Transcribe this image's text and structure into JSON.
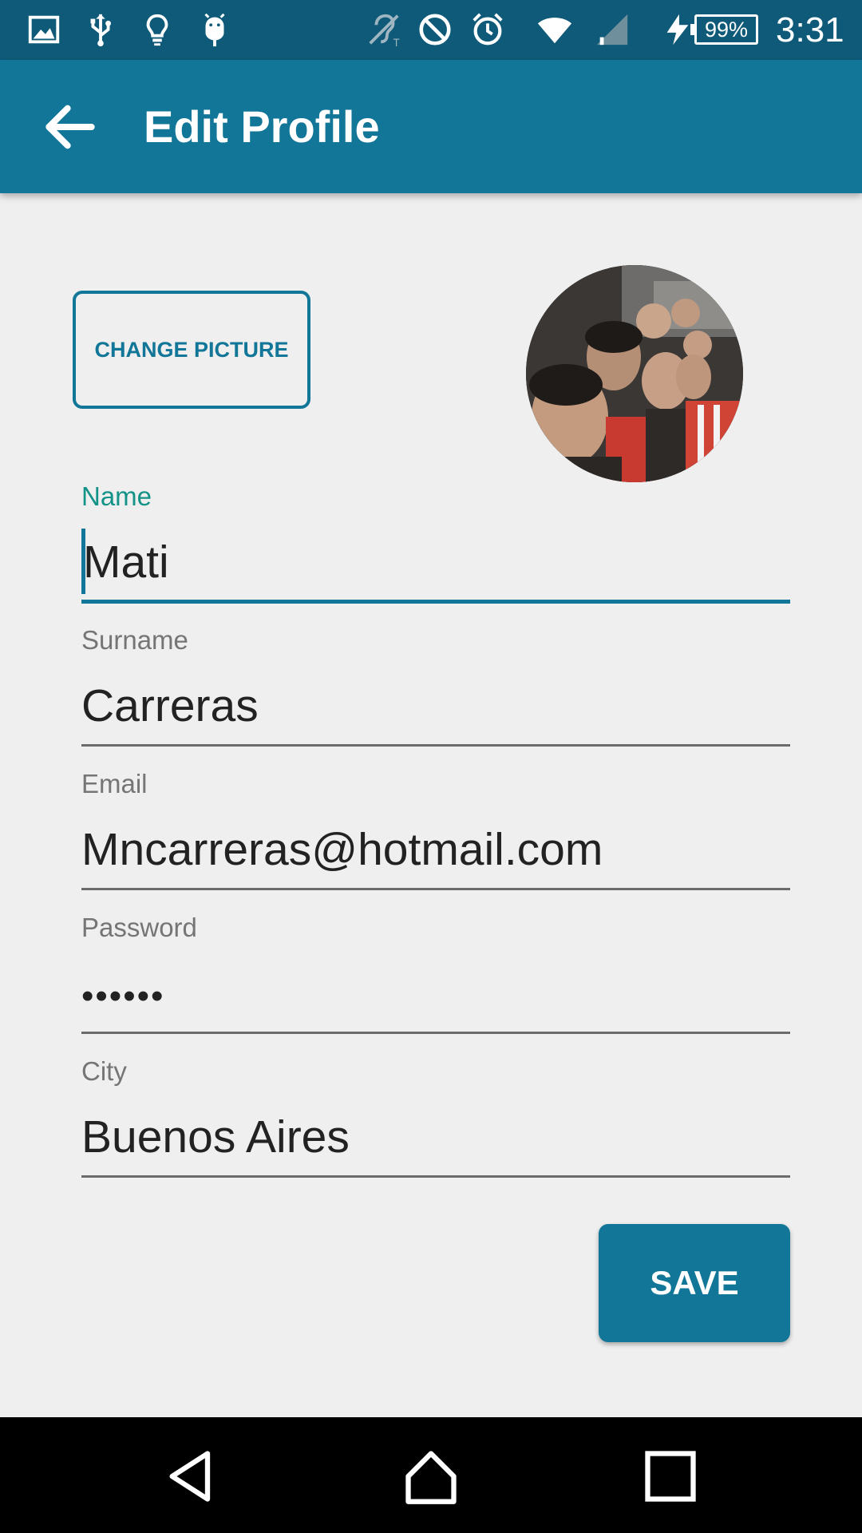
{
  "status_bar": {
    "battery_level": "99%",
    "time": "3:31",
    "icons": [
      "image-icon",
      "usb-icon",
      "lightbulb-icon",
      "android-icon",
      "hearing-aid-icon",
      "do-not-disturb-icon",
      "alarm-icon",
      "wifi-icon",
      "signal-icon",
      "charging-icon",
      "battery-icon"
    ]
  },
  "app_bar": {
    "title": "Edit Profile",
    "back_icon": "arrow-back-icon"
  },
  "profile": {
    "change_picture_label": "CHANGE PICTURE",
    "avatar_alt": "profile-photo"
  },
  "form": {
    "name": {
      "label": "Name",
      "value": "Mati"
    },
    "surname": {
      "label": "Surname",
      "value": "Carreras"
    },
    "email": {
      "label": "Email",
      "value": "Mncarreras@hotmail.com"
    },
    "password": {
      "label": "Password",
      "value": "••••••"
    },
    "city": {
      "label": "City",
      "value": "Buenos Aires"
    }
  },
  "save_label": "SAVE",
  "colors": {
    "primary": "#117697",
    "status_bar": "#0e5a78",
    "accent_label": "#139287",
    "background": "#efefef"
  },
  "nav_bar": {
    "buttons": [
      "back-triangle-icon",
      "home-icon",
      "recents-icon"
    ]
  }
}
